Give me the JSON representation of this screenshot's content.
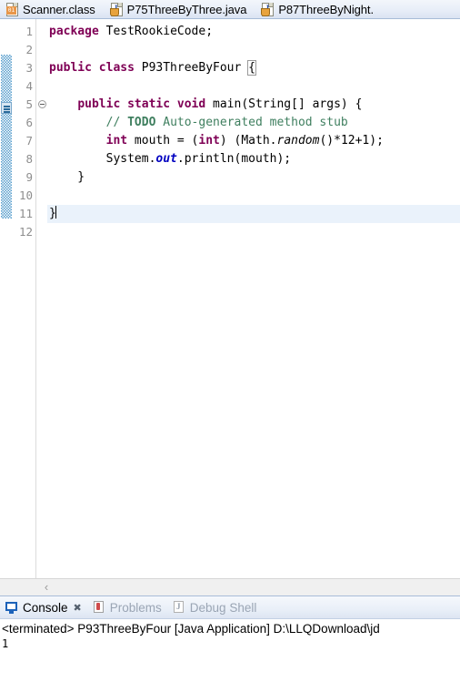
{
  "editor_tabs": [
    {
      "label": "Scanner.class",
      "icon": "class-file-icon",
      "badge": "01"
    },
    {
      "label": "P75ThreeByThree.java",
      "icon": "java-file-icon",
      "badge": "J"
    },
    {
      "label": "P87ThreeByNight.",
      "icon": "java-file-icon",
      "badge": "J"
    }
  ],
  "gutter": {
    "line_numbers": [
      "1",
      "2",
      "3",
      "4",
      "5",
      "6",
      "7",
      "8",
      "9",
      "10",
      "11",
      "12"
    ],
    "fold_marker_line": "5",
    "current_line": "11"
  },
  "code": {
    "lines": [
      {
        "n": "1",
        "segments": [
          {
            "t": "package ",
            "c": "kw"
          },
          {
            "t": "TestRookieCode;",
            "c": "plain"
          }
        ]
      },
      {
        "n": "2",
        "segments": []
      },
      {
        "n": "3",
        "segments": [
          {
            "t": "public class ",
            "c": "kw"
          },
          {
            "t": "P93ThreeByFour ",
            "c": "plain"
          },
          {
            "t": "{",
            "c": "brace-match"
          }
        ]
      },
      {
        "n": "4",
        "segments": []
      },
      {
        "n": "5",
        "segments": [
          {
            "t": "    ",
            "c": "plain"
          },
          {
            "t": "public static void ",
            "c": "kw"
          },
          {
            "t": "main(String[] args) {",
            "c": "plain"
          }
        ]
      },
      {
        "n": "6",
        "segments": [
          {
            "t": "        ",
            "c": "plain"
          },
          {
            "t": "// ",
            "c": "cmt"
          },
          {
            "t": "TODO",
            "c": "cmt-todo"
          },
          {
            "t": " Auto-generated method stub",
            "c": "cmt"
          }
        ]
      },
      {
        "n": "7",
        "segments": [
          {
            "t": "        ",
            "c": "plain"
          },
          {
            "t": "int",
            "c": "kw"
          },
          {
            "t": " mouth = (",
            "c": "plain"
          },
          {
            "t": "int",
            "c": "kw"
          },
          {
            "t": ") (Math.",
            "c": "plain"
          },
          {
            "t": "random",
            "c": "statmeth"
          },
          {
            "t": "()*12+1);",
            "c": "plain"
          }
        ]
      },
      {
        "n": "8",
        "segments": [
          {
            "t": "        System.",
            "c": "plain"
          },
          {
            "t": "out",
            "c": "statfld"
          },
          {
            "t": ".println(mouth);",
            "c": "plain"
          }
        ]
      },
      {
        "n": "9",
        "segments": [
          {
            "t": "    }",
            "c": "plain"
          }
        ]
      },
      {
        "n": "10",
        "segments": []
      },
      {
        "n": "11",
        "segments": [
          {
            "t": "}",
            "c": "plain"
          }
        ],
        "current": true,
        "caret": true
      },
      {
        "n": "12",
        "segments": []
      }
    ]
  },
  "editor_scroll": {
    "left_arrow": "‹"
  },
  "console_tabs": [
    {
      "label": "Console",
      "icon": "console-monitor-icon",
      "active": true,
      "close": "✖"
    },
    {
      "label": "Problems",
      "icon": "problems-icon",
      "active": false
    },
    {
      "label": "Debug Shell",
      "icon": "debug-shell-icon",
      "active": false
    }
  ],
  "console": {
    "launch_line": "<terminated> P93ThreeByFour [Java Application] D:\\LLQDownload\\jd",
    "stdout": "1"
  },
  "colors": {
    "keyword": "#7f0055",
    "comment": "#3f7f5f",
    "static_field": "#0000c0",
    "current_line_bg": "#eaf2fb",
    "change_bar": "#3a8ec4",
    "tabbar_bg": "#e8eef8"
  }
}
